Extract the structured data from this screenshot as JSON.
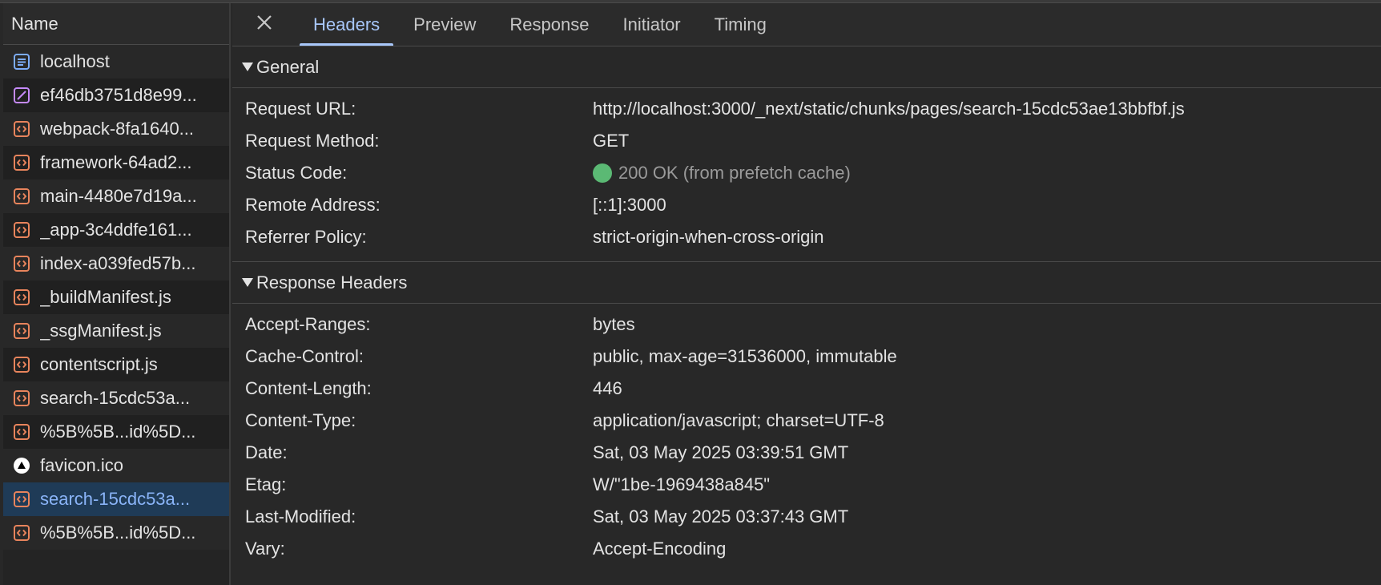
{
  "sidebar": {
    "header": "Name",
    "requests": [
      {
        "name": "localhost",
        "icon": "document-icon"
      },
      {
        "name": "ef46db3751d8e99...",
        "icon": "image-icon"
      },
      {
        "name": "webpack-8fa1640...",
        "icon": "script-icon"
      },
      {
        "name": "framework-64ad2...",
        "icon": "script-icon"
      },
      {
        "name": "main-4480e7d19a...",
        "icon": "script-icon"
      },
      {
        "name": "_app-3c4ddfe161...",
        "icon": "script-icon"
      },
      {
        "name": "index-a039fed57b...",
        "icon": "script-icon"
      },
      {
        "name": "_buildManifest.js",
        "icon": "script-icon"
      },
      {
        "name": "_ssgManifest.js",
        "icon": "script-icon"
      },
      {
        "name": "contentscript.js",
        "icon": "script-icon"
      },
      {
        "name": "search-15cdc53a...",
        "icon": "script-icon"
      },
      {
        "name": "%5B%5B...id%5D...",
        "icon": "script-icon"
      },
      {
        "name": "favicon.ico",
        "icon": "favicon-icon"
      },
      {
        "name": "search-15cdc53a...",
        "icon": "script-icon",
        "selected": true
      },
      {
        "name": "%5B%5B...id%5D...",
        "icon": "script-icon"
      }
    ]
  },
  "tabs": [
    "Headers",
    "Preview",
    "Response",
    "Initiator",
    "Timing"
  ],
  "active_tab": "Headers",
  "general": {
    "title": "General",
    "request_url_label": "Request URL:",
    "request_url": "http://localhost:3000/_next/static/chunks/pages/search-15cdc53ae13bbfbf.js",
    "request_method_label": "Request Method:",
    "request_method": "GET",
    "status_code_label": "Status Code:",
    "status_code": "200 OK (from prefetch cache)",
    "remote_address_label": "Remote Address:",
    "remote_address": "[::1]:3000",
    "referrer_policy_label": "Referrer Policy:",
    "referrer_policy": "strict-origin-when-cross-origin"
  },
  "response_headers": {
    "title": "Response Headers",
    "items": [
      {
        "key": "Accept-Ranges:",
        "value": "bytes"
      },
      {
        "key": "Cache-Control:",
        "value": "public, max-age=31536000, immutable"
      },
      {
        "key": "Content-Length:",
        "value": "446"
      },
      {
        "key": "Content-Type:",
        "value": "application/javascript; charset=UTF-8"
      },
      {
        "key": "Date:",
        "value": "Sat, 03 May 2025 03:39:51 GMT"
      },
      {
        "key": "Etag:",
        "value": "W/\"1be-1969438a845\""
      },
      {
        "key": "Last-Modified:",
        "value": "Sat, 03 May 2025 03:37:43 GMT"
      },
      {
        "key": "Vary:",
        "value": "Accept-Encoding"
      }
    ]
  },
  "colors": {
    "background": "#282828",
    "accent": "#a8c7fa",
    "selected_row": "#1f3b57",
    "status_ok": "#5bb974",
    "script_icon": "#e8845c",
    "image_icon": "#c58af9",
    "document_icon": "#7cacf8"
  }
}
